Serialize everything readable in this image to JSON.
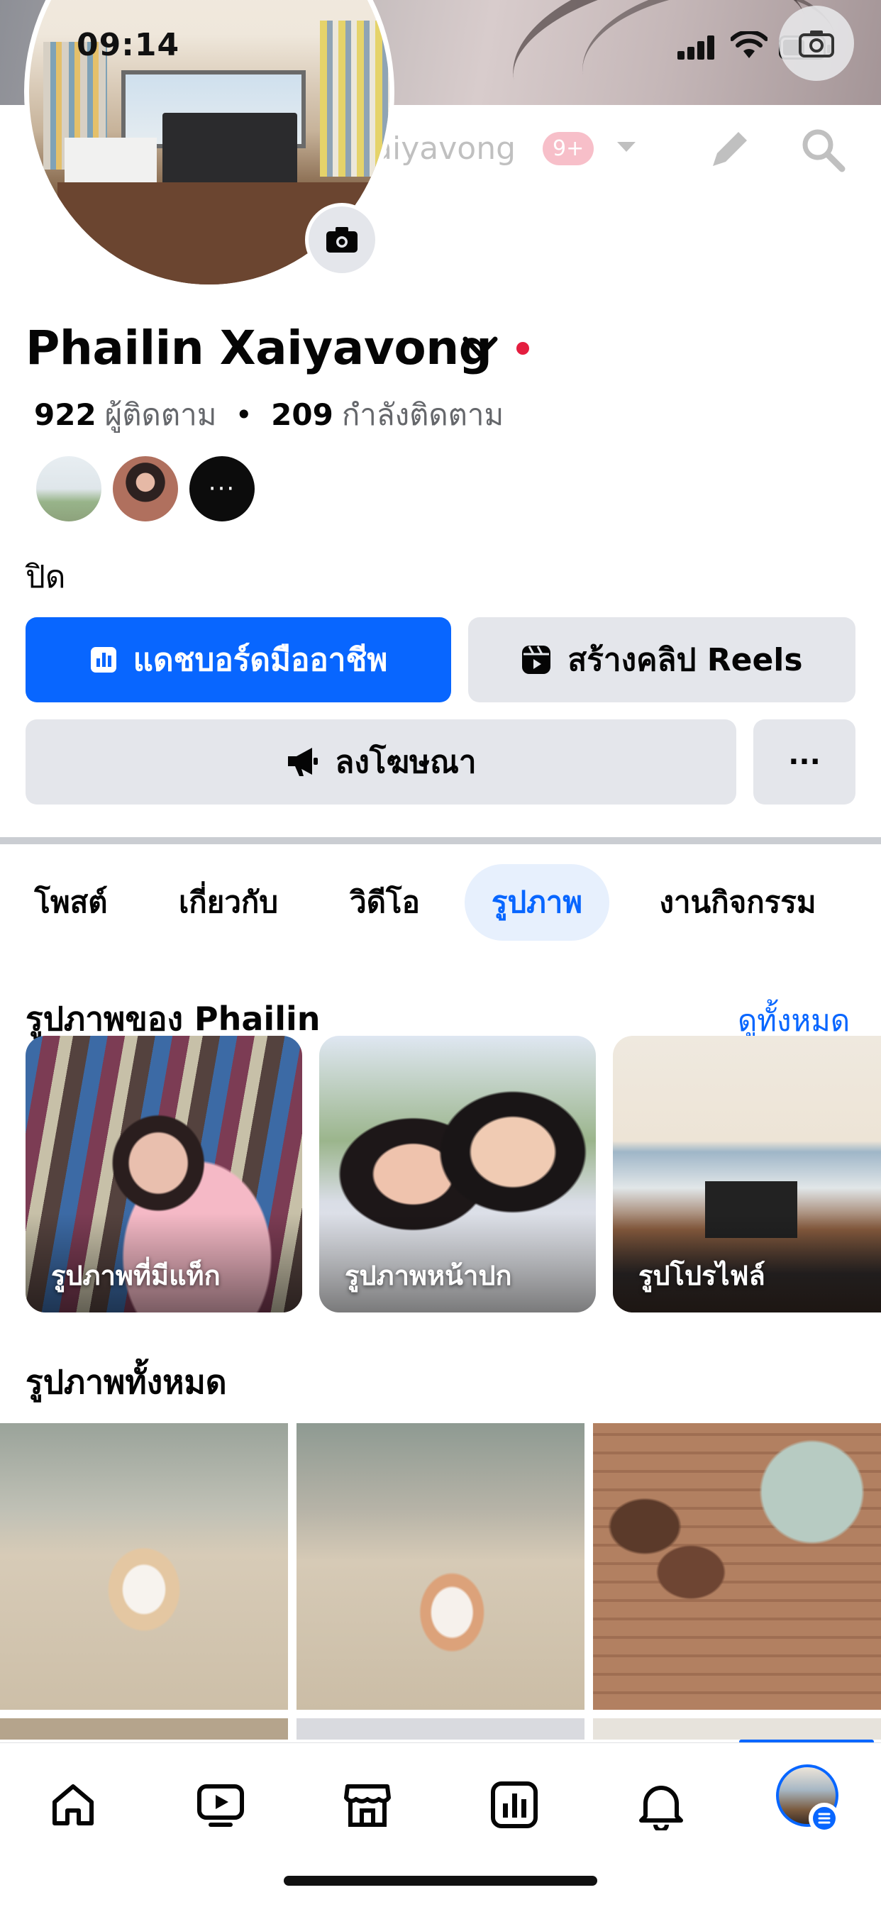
{
  "status_bar": {
    "time": "09:14"
  },
  "top_nav": {
    "title": "Phailin Xaiyavong",
    "notifications_badge": "9+"
  },
  "profile": {
    "name": "Phailin Xaiyavong",
    "followers_count": "922",
    "followers_label": "ผู้ติดตาม",
    "following_count": "209",
    "following_label": "กำลังติดตาม",
    "separator": "•",
    "friend_avatar_3_label": "···",
    "bio": "ปิด"
  },
  "actions": {
    "dashboard_label": "แดชบอร์ดมืออาชีพ",
    "reels_label": "สร้างคลิป Reels",
    "advertise_label": "ลงโฆษณา",
    "more_label": "···"
  },
  "tabs": [
    {
      "label": "โพสต์",
      "active": false
    },
    {
      "label": "เกี่ยวกับ",
      "active": false
    },
    {
      "label": "วิดีโอ",
      "active": false
    },
    {
      "label": "รูปภาพ",
      "active": true
    },
    {
      "label": "งานกิจกรรม",
      "active": false
    }
  ],
  "photos": {
    "albums_title": "รูปภาพของ Phailin",
    "see_all_label": "ดูทั้งหมด",
    "albums": [
      {
        "label": "รูปภาพที่มีแท็ก"
      },
      {
        "label": "รูปภาพหน้าปก"
      },
      {
        "label": "รูปโปรไฟล์"
      }
    ],
    "all_photos_title": "รูปภาพทั้งหมด"
  },
  "bottom_nav": {
    "items": [
      "home-icon",
      "video-icon",
      "marketplace-icon",
      "dashboard-icon",
      "notifications-icon",
      "profile-menu"
    ]
  },
  "colors": {
    "primary": "#0866ff",
    "button_gray": "#e4e6eb",
    "secondary_text": "#65676b",
    "red": "#e41e3f"
  }
}
